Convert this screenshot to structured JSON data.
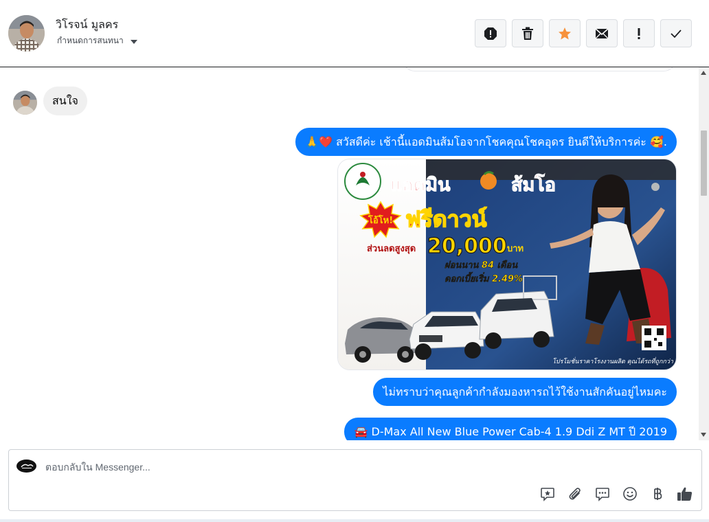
{
  "header": {
    "contact_name": "วิโรจน์ มูลคร",
    "conversation_settings": "กำหนดการสนทนา",
    "actions": [
      {
        "name": "report-icon"
      },
      {
        "name": "trash-icon"
      },
      {
        "name": "star-icon"
      },
      {
        "name": "mail-icon"
      },
      {
        "name": "exclamation-icon"
      },
      {
        "name": "check-icon"
      }
    ]
  },
  "messages": [
    {
      "direction": "incoming",
      "text": "สนใจ"
    },
    {
      "direction": "outgoing",
      "text": "🙏❤️ สวัสดีค่ะ เช้านี้แอดมินส้มโอจากโชคคุณโชคอุดร ยินดีให้บริการค่ะ 🥰."
    },
    {
      "direction": "outgoing",
      "type": "image",
      "image": {
        "title_line1": "แอดมิน",
        "title_line2": "ส้มโอ",
        "badge": "โอ้โห!",
        "headline": "ฟรีดาวน์",
        "discount_label": "ส่วนลดสูงสุด",
        "discount_amount": "20,000",
        "discount_unit": "บาท",
        "installment": "ผ่อนนาน 84 เดือน",
        "interest": "ดอกเบี้ยเริ่ม 2.49%",
        "footer": "โปรโมชั่นราคาโรงงานผลิต คุณได้รถที่ถูกกว่า"
      }
    },
    {
      "direction": "outgoing",
      "text": "ไม่ทราบว่าคุณลูกค้ากำลังมองหารถไว้ใช้งานสักคันอยู่ไหมคะ"
    },
    {
      "direction": "outgoing",
      "text": "🚘 D-Max All New Blue Power Cab-4 1.9 Ddi Z MT ปี 2019"
    }
  ],
  "composer": {
    "placeholder": "ตอบกลับใน Messenger...",
    "tools": [
      {
        "name": "saved-reply-icon"
      },
      {
        "name": "attachment-icon"
      },
      {
        "name": "quick-reply-icon"
      },
      {
        "name": "emoji-icon"
      },
      {
        "name": "baht-payment-icon"
      },
      {
        "name": "like-icon"
      }
    ]
  },
  "colors": {
    "outgoing_bubble": "#0a7cff",
    "incoming_bubble": "#f0f0f0",
    "star": "#f7923b"
  }
}
